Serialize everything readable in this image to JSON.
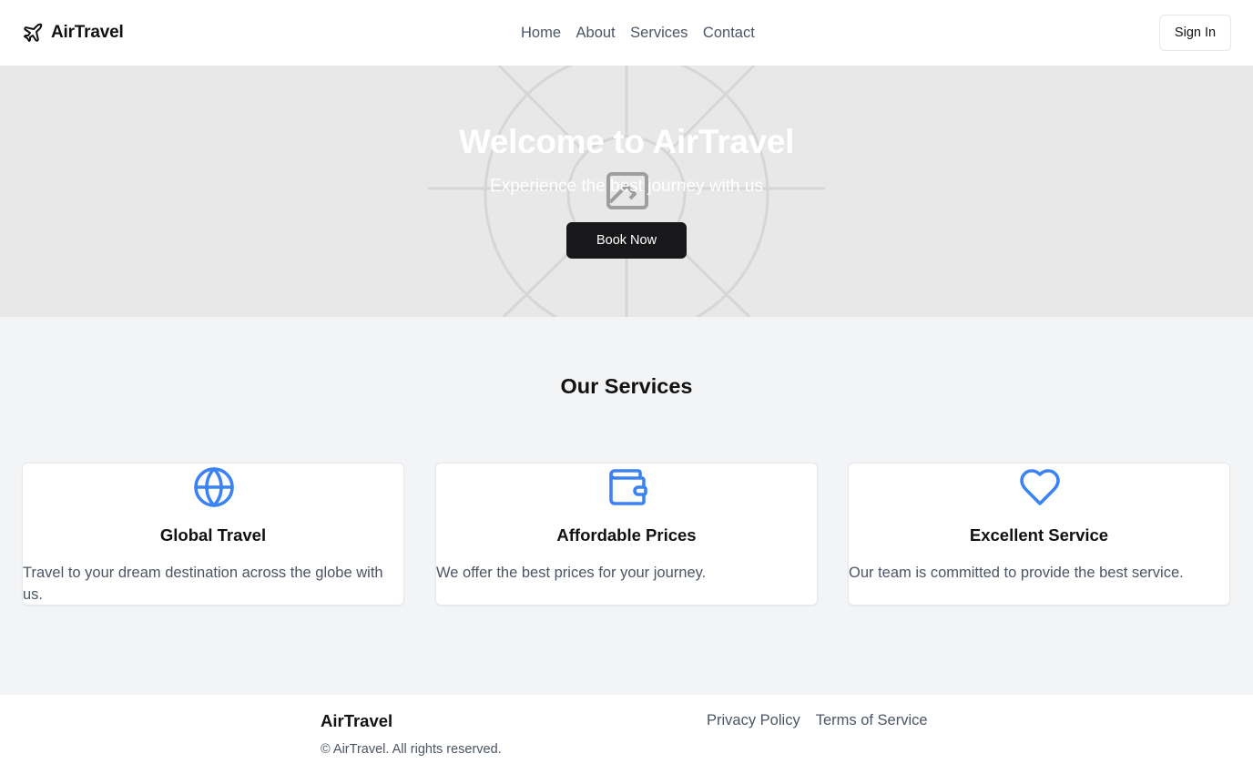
{
  "header": {
    "brand": "AirTravel",
    "nav": [
      "Home",
      "About",
      "Services",
      "Contact"
    ],
    "signin_label": "Sign In"
  },
  "hero": {
    "title": "Welcome to AirTravel",
    "subtitle": "Experience the best journey with us",
    "cta_label": "Book Now",
    "image_placeholder_icon": "broken-image-icon"
  },
  "services": {
    "title": "Our Services",
    "accent_color": "#3b82f6",
    "cards": [
      {
        "icon": "globe-icon",
        "title": "Global Travel",
        "description": "Travel to your dream destination across the globe with us."
      },
      {
        "icon": "wallet-icon",
        "title": "Affordable Prices",
        "description": "We offer the best prices for your journey."
      },
      {
        "icon": "heart-icon",
        "title": "Excellent Service",
        "description": "Our team is committed to provide the best service."
      }
    ]
  },
  "footer": {
    "brand": "AirTravel",
    "copyright": "© AirTravel. All rights reserved.",
    "links": [
      "Privacy Policy",
      "Terms of Service"
    ]
  }
}
